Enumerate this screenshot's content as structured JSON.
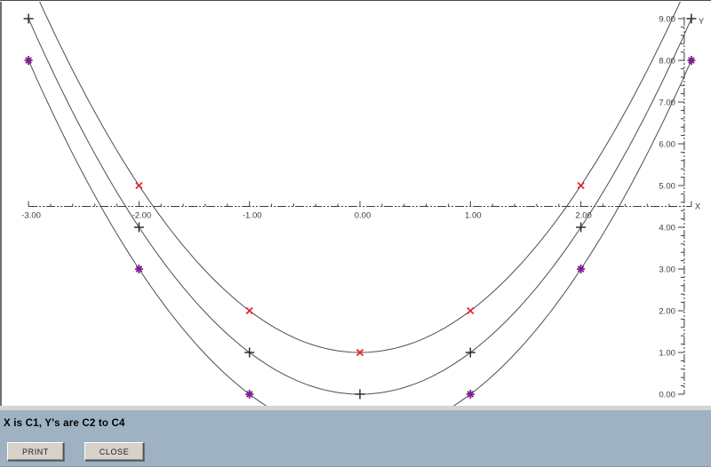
{
  "window": {
    "statusbar": {
      "text": "X is C1, Y's are C2 to C4",
      "bg": "#9fb2c4"
    },
    "buttons": {
      "print": "PRINT",
      "close": "CLOSE"
    }
  },
  "chart_data": {
    "type": "line",
    "title": "",
    "xlabel": "X",
    "ylabel": "Y",
    "xlim": [
      -3,
      3
    ],
    "ylim": [
      0,
      9
    ],
    "x_axis_cross_y": 4.5,
    "grid": false,
    "minor_tick_step": 0.2,
    "x_ticks": [
      -3,
      -2,
      -1,
      0,
      1,
      2
    ],
    "x_tick_labels": [
      "-3.00",
      "-2.00",
      "-1.00",
      "0.00",
      "1.00",
      "2.00"
    ],
    "y_ticks": [
      0,
      1,
      2,
      3,
      4,
      5,
      6,
      7,
      8,
      9
    ],
    "y_tick_labels": [
      "0.00",
      "1.00",
      "2.00",
      "3.00",
      "4.00",
      "5.00",
      "6.00",
      "7.00",
      "8.00",
      "9.00"
    ],
    "axis_color": "#3c3c3c",
    "curve_color": "#4d4d57",
    "series": [
      {
        "name": "C2",
        "marker": "plus",
        "color": "#2f2f2f",
        "curve": {
          "type": "parabola",
          "coeff": 1,
          "offset": 0
        },
        "points": [
          [
            -3,
            9
          ],
          [
            -2,
            4
          ],
          [
            -1,
            1
          ],
          [
            0,
            0
          ],
          [
            1,
            1
          ],
          [
            2,
            4
          ],
          [
            3,
            9
          ]
        ]
      },
      {
        "name": "C3",
        "marker": "cross",
        "color": "#e02a2a",
        "curve": {
          "type": "parabola",
          "coeff": 1,
          "offset": 1
        },
        "points": [
          [
            -2,
            5
          ],
          [
            -1,
            2
          ],
          [
            0,
            1
          ],
          [
            1,
            2
          ],
          [
            2,
            5
          ]
        ]
      },
      {
        "name": "C4",
        "marker": "asterisk",
        "color": "#7c1f90",
        "curve": {
          "type": "parabola",
          "coeff": 1,
          "offset": -1
        },
        "points": [
          [
            -3,
            8
          ],
          [
            -2,
            3
          ],
          [
            -1,
            0
          ],
          [
            1,
            0
          ],
          [
            2,
            3
          ],
          [
            3,
            8
          ]
        ]
      }
    ]
  }
}
